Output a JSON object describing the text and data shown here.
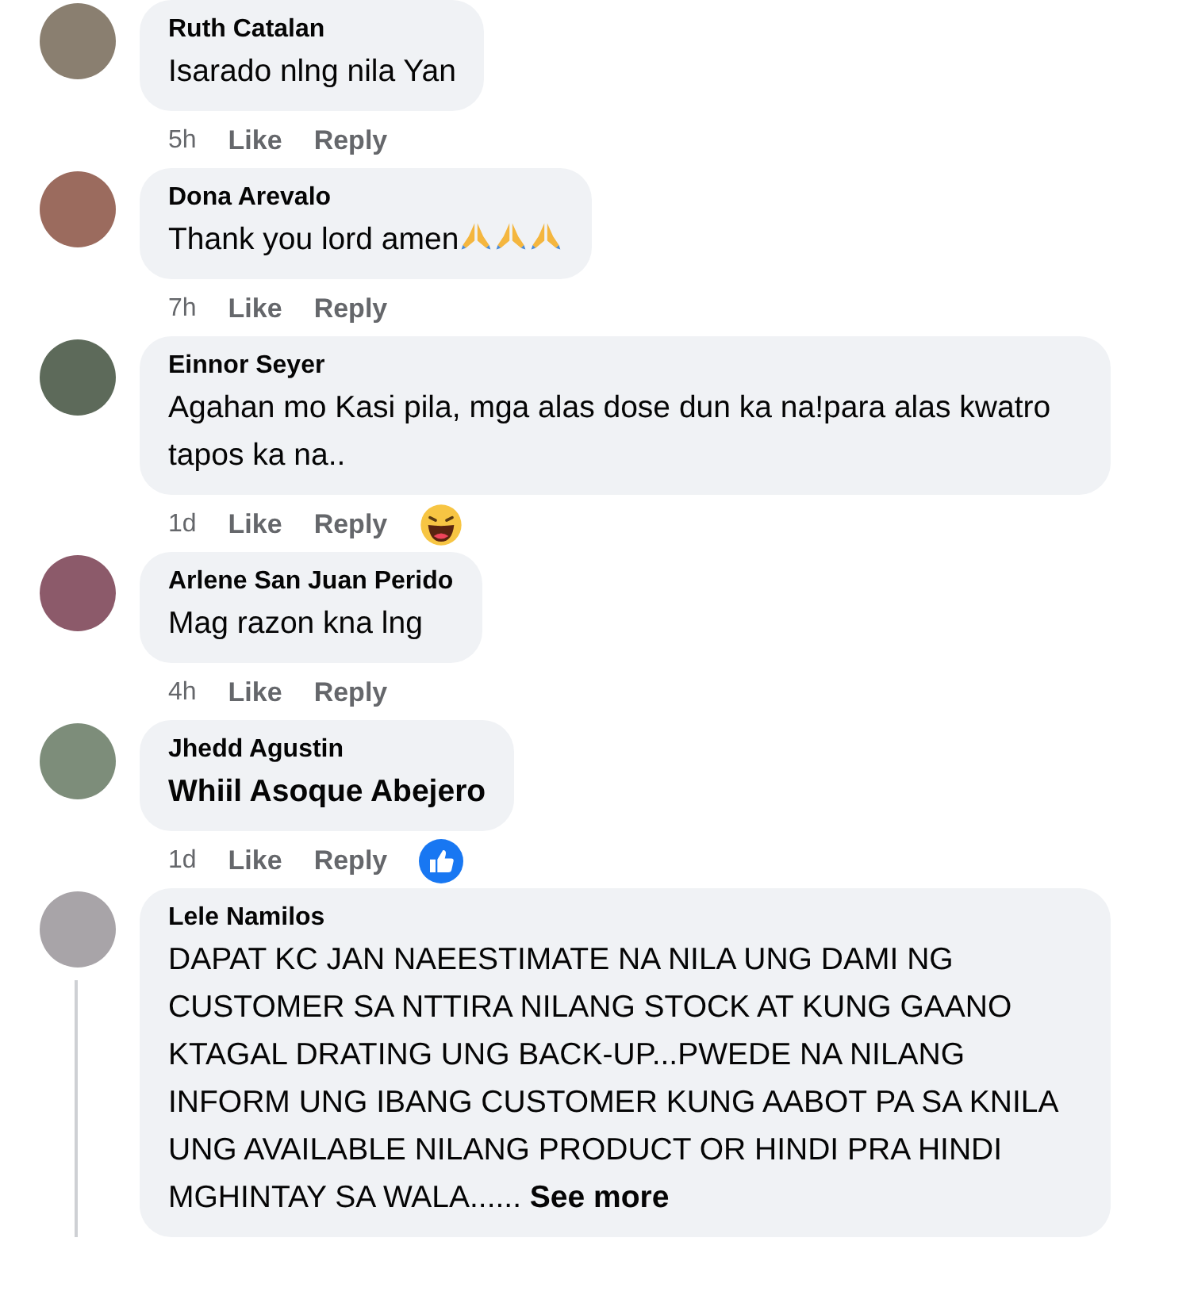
{
  "comments": [
    {
      "author": "Ruth Catalan",
      "text": "Isarado nlng nila Yan",
      "time": "5h",
      "like": "Like",
      "reply": "Reply",
      "thread": false
    },
    {
      "author": "Dona Arevalo",
      "text": "Thank you lord amen",
      "emoji": [
        {
          "kind": "pray"
        },
        {
          "kind": "pray"
        },
        {
          "kind": "pray"
        }
      ],
      "time": "7h",
      "like": "Like",
      "reply": "Reply",
      "thread": false
    },
    {
      "author": "Einnor Seyer",
      "text": "Agahan mo Kasi pila, mga alas dose dun ka na!para alas kwatro tapos ka na..",
      "time": "1d",
      "like": "Like",
      "reply": "Reply",
      "reactions": [
        {
          "kind": "haha"
        }
      ],
      "thread": false
    },
    {
      "author": "Arlene San Juan Perido",
      "text": "Mag razon kna lng",
      "time": "4h",
      "like": "Like",
      "reply": "Reply",
      "thread": false
    },
    {
      "author": "Jhedd Agustin",
      "text": "**Whiil Asoque Abejero**",
      "time": "1d",
      "like": "Like",
      "reply": "Reply",
      "reactions": [
        {
          "kind": "like"
        }
      ],
      "thread": false
    },
    {
      "author": "Lele Namilos",
      "text": "DAPAT KC JAN NAEESTIMATE NA NILA UNG DAMI NG CUSTOMER SA NTTIRA NILANG STOCK AT KUNG GAANO KTAGAL DRATING UNG BACK-UP...PWEDE NA NILANG INFORM UNG IBANG CUSTOMER KUNG AABOT PA SA KNILA UNG AVAILABLE NILANG PRODUCT OR HINDI PRA HINDI MGHINTAY SA WALA......",
      "see_more": "See more",
      "thread": true
    }
  ]
}
